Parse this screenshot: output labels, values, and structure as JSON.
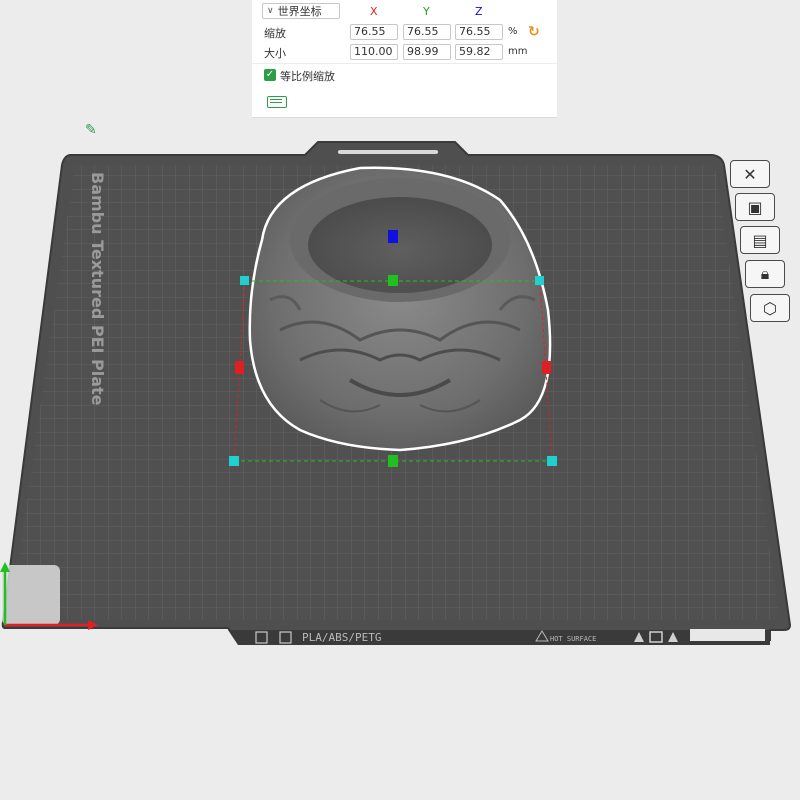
{
  "panel": {
    "coord_system": "世界坐标",
    "axes": {
      "x": "X",
      "y": "Y",
      "z": "Z"
    },
    "scale": {
      "label": "缩放",
      "x": "76.55",
      "y": "76.55",
      "z": "76.55",
      "unit": "%"
    },
    "size": {
      "label": "大小",
      "x": "110.00",
      "y": "98.99",
      "z": "59.82",
      "unit": "mm"
    },
    "uniform_scale": {
      "label": "等比例缩放",
      "checked": true
    }
  },
  "plate": {
    "brand_text": "Bambu Textured PEI Plate",
    "material_text": "PLA/ABS/PETG",
    "hot_surface_text": "HOT SURFACE"
  },
  "colors": {
    "accent_green": "#2e9d4a",
    "reset_orange": "#f08a24",
    "axis_x": "#e02020",
    "axis_y": "#20c020",
    "axis_z": "#1010e0",
    "handle_cyan": "#20d0d0"
  },
  "side_toolbar": [
    "close-icon",
    "monitor-icon",
    "layout-icon",
    "lock-icon",
    "settings-hex-icon"
  ]
}
